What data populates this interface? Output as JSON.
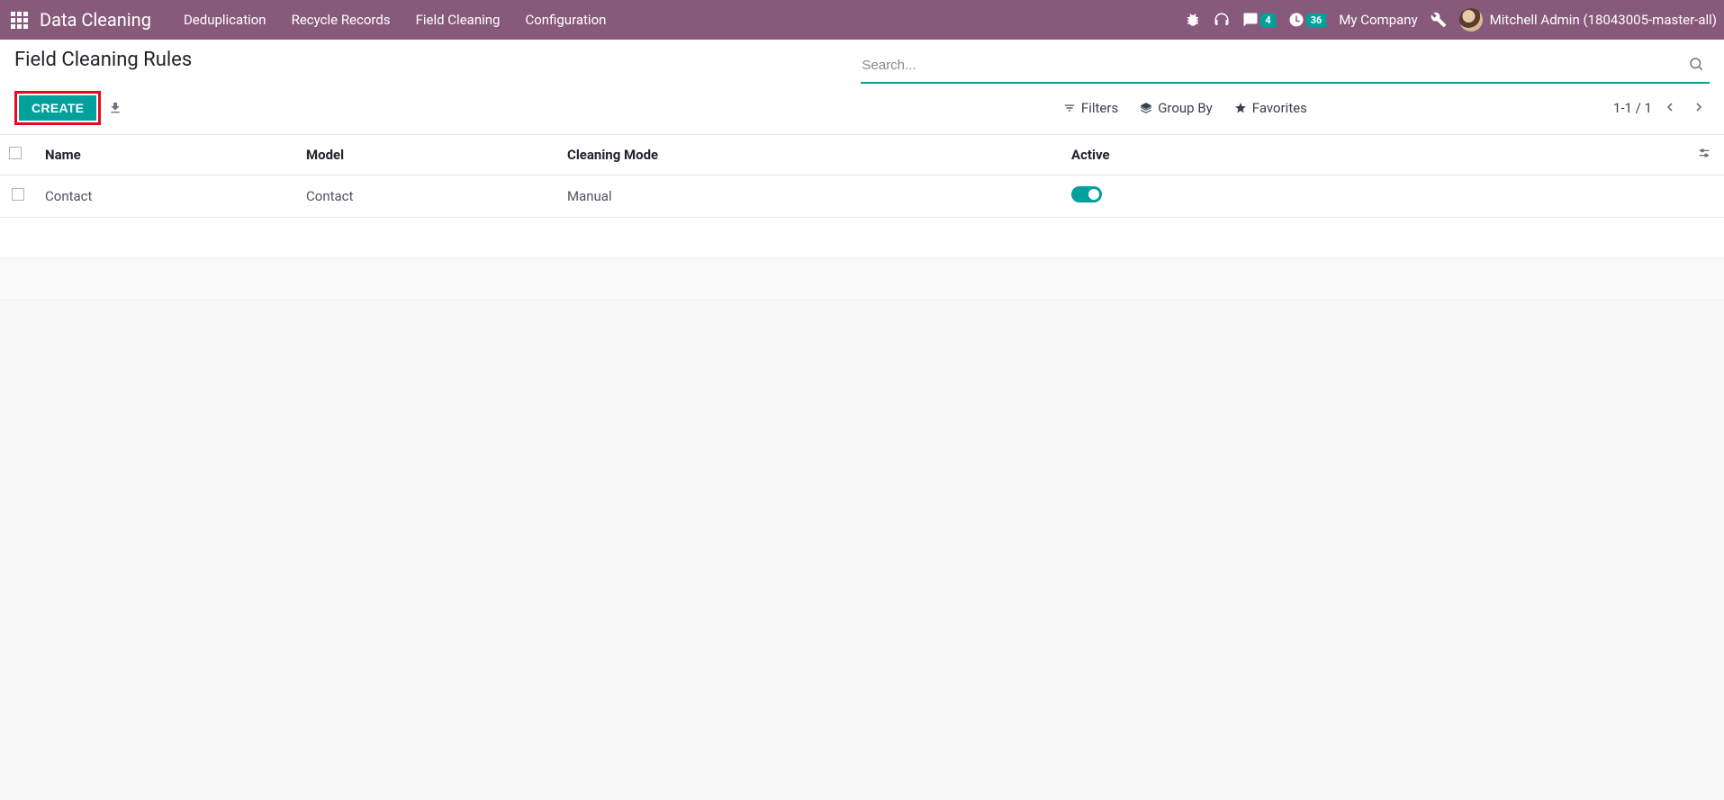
{
  "navbar": {
    "app_title": "Data Cleaning",
    "menu": [
      "Deduplication",
      "Recycle Records",
      "Field Cleaning",
      "Configuration"
    ],
    "messages_badge": "4",
    "activities_badge": "36",
    "company": "My Company",
    "user": "Mitchell Admin (18043005-master-all)"
  },
  "control_panel": {
    "title": "Field Cleaning Rules",
    "search_placeholder": "Search...",
    "create_label": "CREATE",
    "filters_label": "Filters",
    "groupby_label": "Group By",
    "favorites_label": "Favorites",
    "pager": "1-1 / 1"
  },
  "table": {
    "columns": {
      "name": "Name",
      "model": "Model",
      "mode": "Cleaning Mode",
      "active": "Active"
    },
    "rows": [
      {
        "name": "Contact",
        "model": "Contact",
        "mode": "Manual",
        "active": true
      }
    ]
  }
}
